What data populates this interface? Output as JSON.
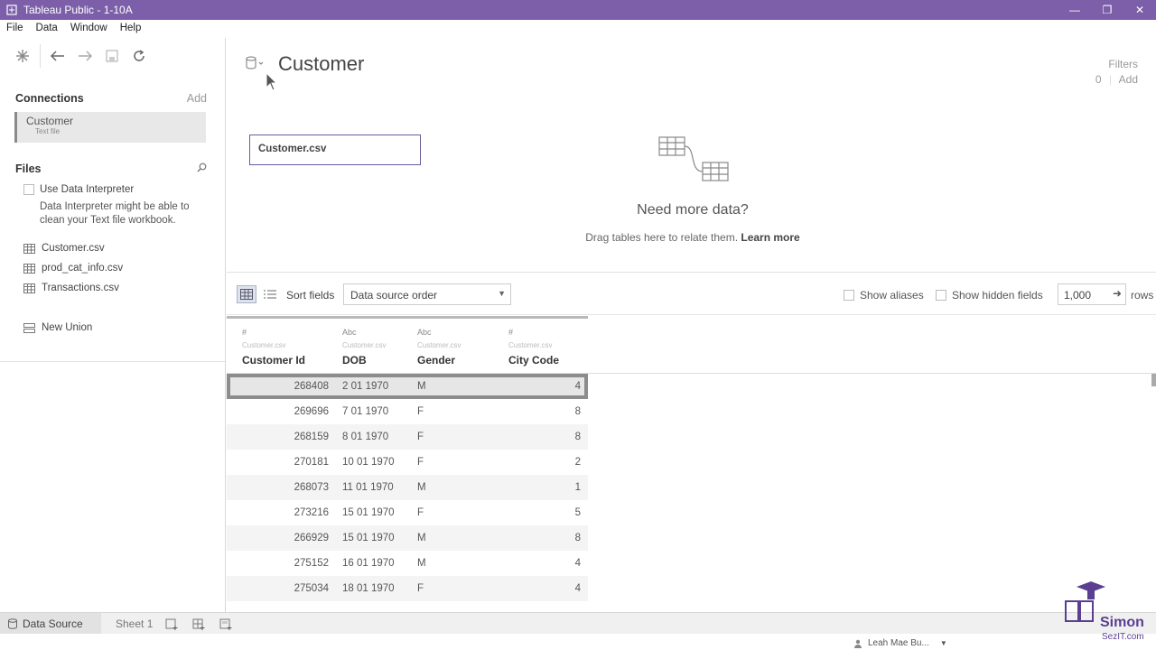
{
  "window": {
    "title": "Tableau Public - 1-10A"
  },
  "menu": [
    "File",
    "Data",
    "Window",
    "Help"
  ],
  "connections": {
    "heading": "Connections",
    "add_label": "Add",
    "items": [
      {
        "name": "Customer",
        "type": "Text file"
      }
    ]
  },
  "files": {
    "heading": "Files",
    "use_interpreter_label": "Use Data Interpreter",
    "interpreter_note_1": "Data Interpreter might be able to",
    "interpreter_note_2": "clean your Text file workbook.",
    "list": [
      "Customer.csv",
      "prod_cat_info.csv",
      "Transactions.csv"
    ],
    "new_union": "New Union"
  },
  "datasource": {
    "title": "Customer",
    "filters_label": "Filters",
    "filters_count": "0",
    "filters_add": "Add",
    "table_chip": "Customer.csv",
    "need_more_title": "Need more data?",
    "need_more_text": "Drag tables here to relate them.",
    "learn_more": "Learn more"
  },
  "grid_toolbar": {
    "sort_label": "Sort fields",
    "sort_value": "Data source order",
    "show_aliases": "Show aliases",
    "show_hidden": "Show hidden fields",
    "rows_value": "1,000",
    "rows_label": "rows"
  },
  "columns": [
    {
      "type_icon": "#",
      "source": "Customer.csv",
      "name": "Customer Id"
    },
    {
      "type_icon": "Abc",
      "source": "Customer.csv",
      "name": "DOB"
    },
    {
      "type_icon": "Abc",
      "source": "Customer.csv",
      "name": "Gender"
    },
    {
      "type_icon": "#",
      "source": "Customer.csv",
      "name": "City Code"
    }
  ],
  "rows": [
    [
      "268408",
      "2 01 1970",
      "M",
      "4"
    ],
    [
      "269696",
      "7 01 1970",
      "F",
      "8"
    ],
    [
      "268159",
      "8 01 1970",
      "F",
      "8"
    ],
    [
      "270181",
      "10 01 1970",
      "F",
      "2"
    ],
    [
      "268073",
      "11 01 1970",
      "M",
      "1"
    ],
    [
      "273216",
      "15 01 1970",
      "F",
      "5"
    ],
    [
      "266929",
      "15 01 1970",
      "M",
      "8"
    ],
    [
      "275152",
      "16 01 1970",
      "M",
      "4"
    ],
    [
      "275034",
      "18 01 1970",
      "F",
      "4"
    ]
  ],
  "bottom_tabs": {
    "data_source": "Data Source",
    "sheet": "Sheet 1"
  },
  "status": {
    "user": "Leah Mae Bu..."
  },
  "watermark": {
    "line1": "Simon",
    "line2": "SezIT.com"
  },
  "colors": {
    "titlebar": "#7c5fa8",
    "accent": "#6a5a9a"
  }
}
